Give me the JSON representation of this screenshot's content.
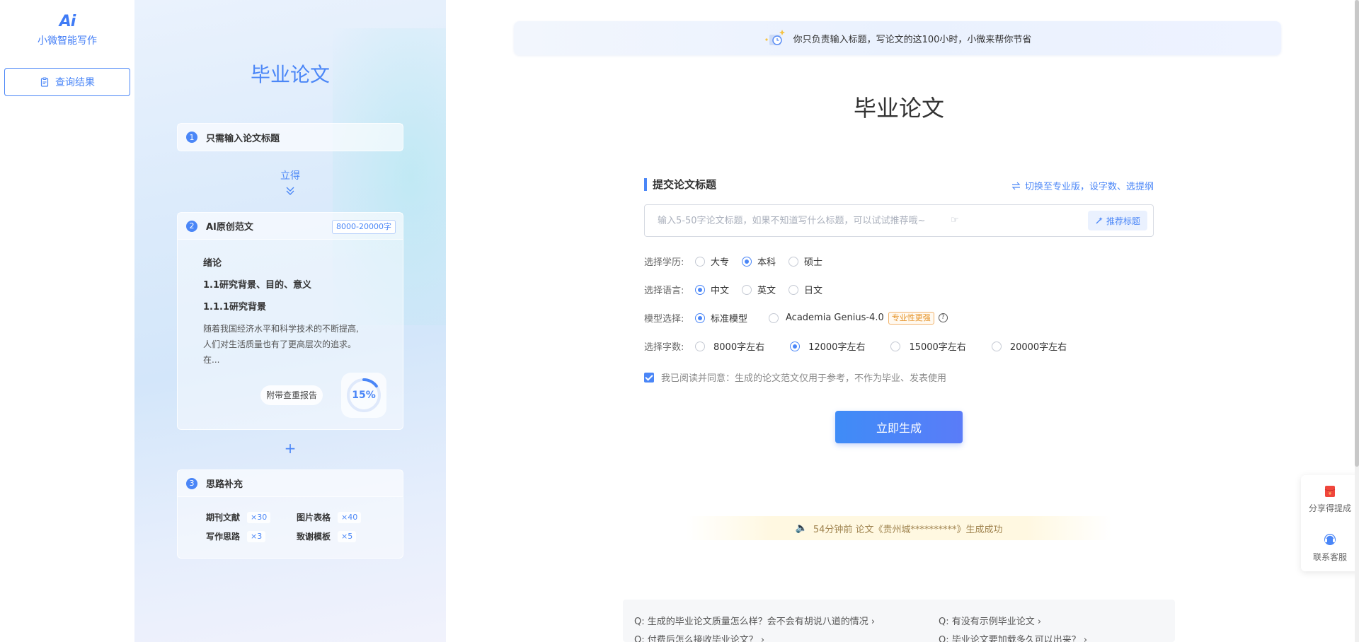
{
  "nav": {
    "logo_mark": "Ai",
    "logo_text": "小微智能写作",
    "query_button": "查询结果"
  },
  "intro": {
    "title": "毕业论文",
    "step1": {
      "num": "1",
      "label": "只需输入论文标题"
    },
    "arrow_text": "立得",
    "step2": {
      "num": "2",
      "label": "AI原创范文",
      "badge": "8000-20000字",
      "h1": "绪论",
      "h2": "1.1研究背景、目的、意义",
      "h3": "1.1.1研究背景",
      "p1": "随着我国经济水平和科学技术的不断提高,",
      "p2": "人们对生活质量也有了更高层次的追求。",
      "p3": "在...",
      "report_tag": "附带查重报告",
      "ring_value": "15%",
      "ring_fraction": 0.15
    },
    "plus": "+",
    "step3": {
      "num": "3",
      "label": "思路补充",
      "items": [
        {
          "label": "期刊文献",
          "mult": "×30"
        },
        {
          "label": "图片表格",
          "mult": "×40"
        },
        {
          "label": "写作思路",
          "mult": "×3"
        },
        {
          "label": "致谢模板",
          "mult": "×5"
        }
      ]
    }
  },
  "banner": {
    "text": "你只负责输入标题，写论文的这100小时，小微来帮你节省"
  },
  "main": {
    "title": "毕业论文",
    "section_label": "提交论文标题",
    "switch_link": "切换至专业版，设字数、选提纲",
    "input_placeholder": "输入5-50字论文标题，如果不知道写什么标题，可以试试推荐哦~",
    "input_value": "",
    "recommend_button": "推荐标题",
    "degree": {
      "label": "选择学历:",
      "options": [
        "大专",
        "本科",
        "硕士"
      ],
      "selected": "本科"
    },
    "language": {
      "label": "选择语言:",
      "options": [
        "中文",
        "英文",
        "日文"
      ],
      "selected": "中文"
    },
    "model": {
      "label": "模型选择:",
      "options": [
        "标准模型",
        "Academia Genius-4.0"
      ],
      "selected": "标准模型",
      "pro_tag": "专业性更强"
    },
    "words": {
      "label": "选择字数:",
      "options": [
        "8000字左右",
        "12000字左右",
        "15000字左右",
        "20000字左右"
      ],
      "selected": "12000字左右"
    },
    "agree_text": "我已阅读并同意：生成的论文范文仅用于参考，不作为毕业、发表使用",
    "agree_checked": true,
    "generate_button": "立即生成",
    "notice": "54分钟前 论文《贵州城**********》生成成功"
  },
  "faq": [
    "Q:  生成的毕业论文质量怎么样？会不会有胡说八道的情况",
    "Q:  有没有示例毕业论文",
    "Q:  付费后怎么接收毕业论文？",
    "Q:  毕业论文要加载多久可以出来？"
  ],
  "float": {
    "share": "分享得提成",
    "service": "联系客服"
  },
  "colors": {
    "accent": "#4a86f7",
    "pro_tag": "#e6952c",
    "notice_bg": "#fff8e1"
  }
}
